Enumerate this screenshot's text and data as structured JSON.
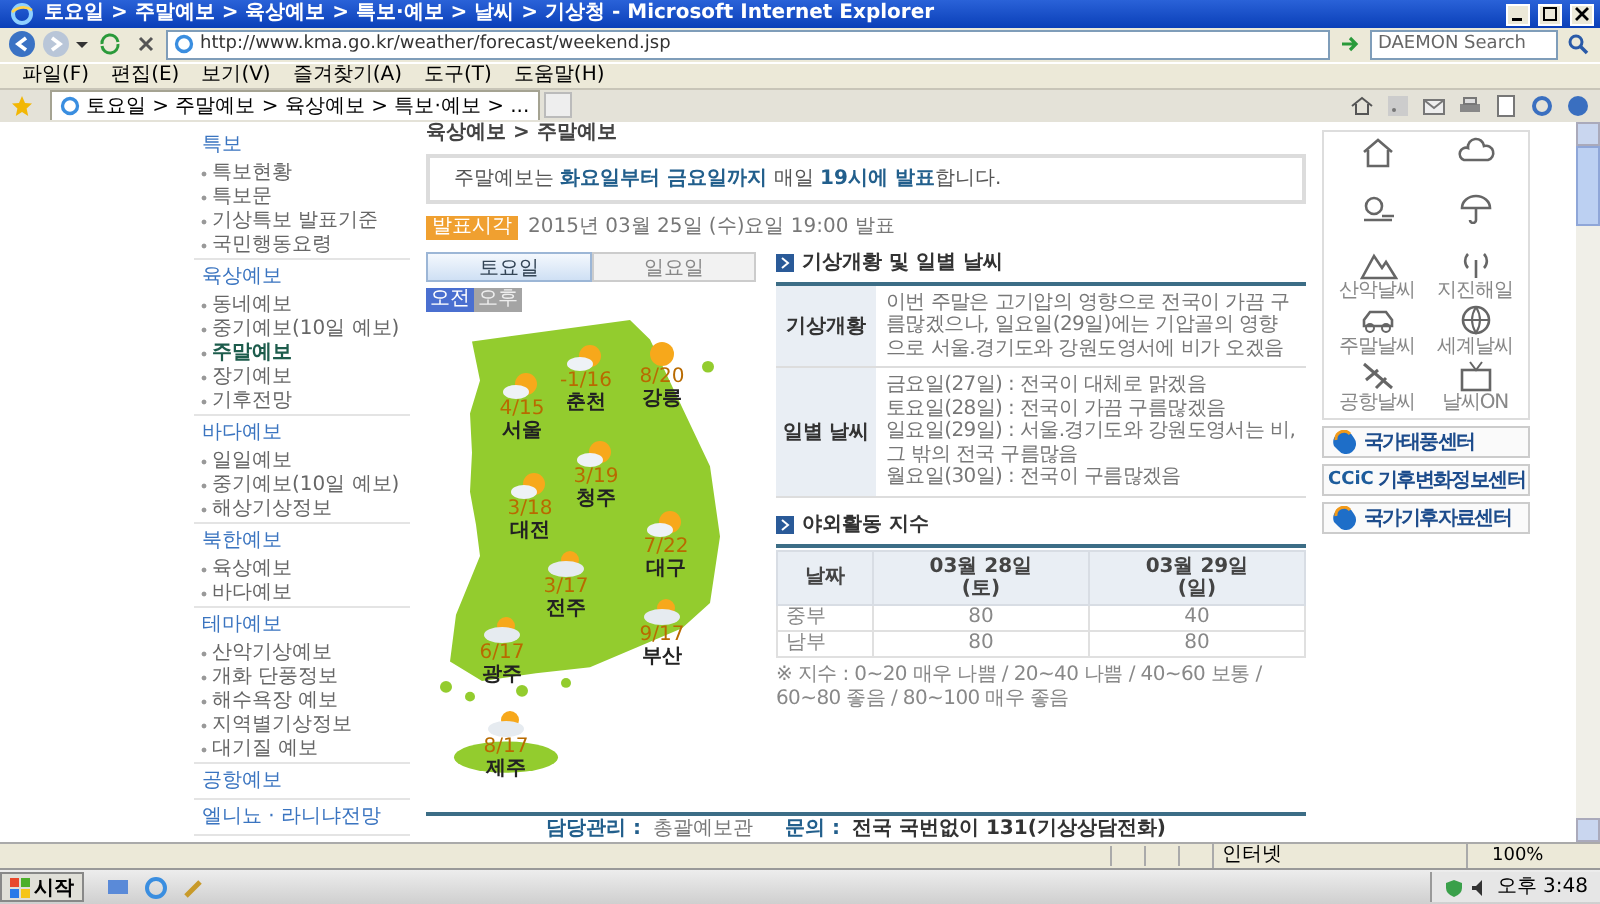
{
  "browser": {
    "title": "토요일 > 주말예보 > 육상예보 > 특보·예보 > 날씨 > 기상청 - Microsoft Internet Explorer",
    "url": "http://www.kma.go.kr/weather/forecast/weekend.jsp",
    "search_placeholder": "DAEMON Search",
    "menu": [
      "파일(F)",
      "편집(E)",
      "보기(V)",
      "즐겨찾기(A)",
      "도구(T)",
      "도움말(H)"
    ],
    "tab": "토요일 > 주말예보 > 육상예보 > 특보·예보 > ..."
  },
  "sidebar": [
    {
      "title": "특보",
      "items": [
        {
          "label": "특보현황",
          "selected": false
        },
        {
          "label": "특보문",
          "selected": false
        },
        {
          "label": "기상특보 발표기준",
          "selected": false
        },
        {
          "label": "국민행동요령",
          "selected": false
        }
      ]
    },
    {
      "title": "육상예보",
      "items": [
        {
          "label": "동네예보",
          "selected": false
        },
        {
          "label": "중기예보(10일 예보)",
          "selected": false
        },
        {
          "label": "주말예보",
          "selected": true
        },
        {
          "label": "장기예보",
          "selected": false
        },
        {
          "label": "기후전망",
          "selected": false
        }
      ]
    },
    {
      "title": "바다예보",
      "items": [
        {
          "label": "일일예보",
          "selected": false
        },
        {
          "label": "중기예보(10일 예보)",
          "selected": false
        },
        {
          "label": "해상기상정보",
          "selected": false
        }
      ]
    },
    {
      "title": "북한예보",
      "items": [
        {
          "label": "육상예보",
          "selected": false
        },
        {
          "label": "바다예보",
          "selected": false
        }
      ]
    },
    {
      "title": "테마예보",
      "items": [
        {
          "label": "산악기상예보",
          "selected": false
        },
        {
          "label": "개화 단풍정보",
          "selected": false
        },
        {
          "label": "해수욕장 예보",
          "selected": false
        },
        {
          "label": "지역별기상정보",
          "selected": false
        },
        {
          "label": "대기질 예보",
          "selected": false
        }
      ]
    },
    {
      "title": "공항예보"
    },
    {
      "title": "엘니뇨 · 라니냐전망"
    }
  ],
  "page_title": "육상예보 > 주말예보",
  "notice": "주말예보는 **화요일부터 금요일까지** 매일 **19시에 발표**합니다.",
  "issue": {
    "badge": "발표시각",
    "time": "2015년 03월 25일 (수)요일 19:00 발표"
  },
  "day_tabs": [
    {
      "label": "토요일",
      "selected": true
    },
    {
      "label": "일요일",
      "selected": false
    }
  ],
  "period_tabs": [
    {
      "label": "오전",
      "selected": true
    },
    {
      "label": "오후",
      "selected": false
    }
  ],
  "cities": [
    {
      "name": "서울",
      "temp": "4/15",
      "kind": "partly_cloudy"
    },
    {
      "name": "춘천",
      "temp": "-1/16",
      "kind": "partly_cloudy"
    },
    {
      "name": "강릉",
      "temp": "8/20",
      "kind": "sunny"
    },
    {
      "name": "청주",
      "temp": "3/19",
      "kind": "partly_cloudy"
    },
    {
      "name": "대전",
      "temp": "3/18",
      "kind": "partly_cloudy"
    },
    {
      "name": "대구",
      "temp": "7/22",
      "kind": "partly_cloudy"
    },
    {
      "name": "전주",
      "temp": "3/17",
      "kind": "mostly_cloudy"
    },
    {
      "name": "광주",
      "temp": "6/17",
      "kind": "mostly_cloudy"
    },
    {
      "name": "부산",
      "temp": "9/17",
      "kind": "mostly_cloudy"
    },
    {
      "name": "제주",
      "temp": "8/17",
      "kind": "mostly_cloudy"
    }
  ],
  "outlook": {
    "title": "기상개황 및 일별 날씨",
    "rows": [
      {
        "label": "기상개황",
        "lines": [
          "이번 주말은 고기압의 영향으로 전국이 가끔 구름많겠으나, 일요일(29일)에는 기압골의 영향으로 서울.경기도와 강원도영서에 비가 오겠음"
        ]
      },
      {
        "label": "일별 날씨",
        "lines": [
          "금요일(27일) : 전국이 대체로 맑겠음",
          "토요일(28일) : 전국이 가끔 구름많겠음",
          "일요일(29일) : 서울.경기도와 강원도영서는 비, 그 밖의 전국 구름많음",
          "월요일(30일) : 전국이 구름많겠음"
        ]
      }
    ]
  },
  "activity": {
    "title": "야외활동 지수",
    "columns": [
      {
        "date": "날짜"
      },
      {
        "date": "03월 28일",
        "day": "(토)"
      },
      {
        "date": "03월 29일",
        "day": "(일)"
      }
    ],
    "rows": [
      [
        "중부",
        "80",
        "40"
      ],
      [
        "남부",
        "80",
        "80"
      ]
    ],
    "note": "※ 지수 : 0~20 매우 나쁨 / 20~40 나쁨 / 40~60 보통 / 60~80 좋음 / 80~100 매우 좋음"
  },
  "footer": [
    {
      "label": "담당관리 :",
      "value": "총괄예보관"
    },
    {
      "label": "문의 :",
      "value": "전국 국번없이 131(기상상담전화)"
    }
  ],
  "quick_links": [
    {
      "kind": "house"
    },
    {
      "kind": "cloud"
    },
    {
      "kind": "sun"
    },
    {
      "kind": "umbrella"
    },
    {
      "kind": "mountain",
      "label": "산악날씨"
    },
    {
      "kind": "antenna",
      "label": "지진해일"
    },
    {
      "kind": "car",
      "label": "주말날씨"
    },
    {
      "kind": "globe",
      "label": "세계날씨"
    },
    {
      "kind": "plane",
      "label": "공항날씨"
    },
    {
      "kind": "tv",
      "label": "날씨ON"
    }
  ],
  "banners": [
    {
      "kind": "swirl",
      "text": "국가태풍센터"
    },
    {
      "kind": "ccic",
      "logo": "CCiC",
      "text": "기후변화정보센터"
    },
    {
      "kind": "swirl",
      "text": "국가기후자료센터"
    }
  ],
  "status_bar": {
    "zone": "인터넷",
    "zoom": "100%"
  },
  "taskbar": {
    "start": "시작",
    "clock": "오후 3:48"
  }
}
